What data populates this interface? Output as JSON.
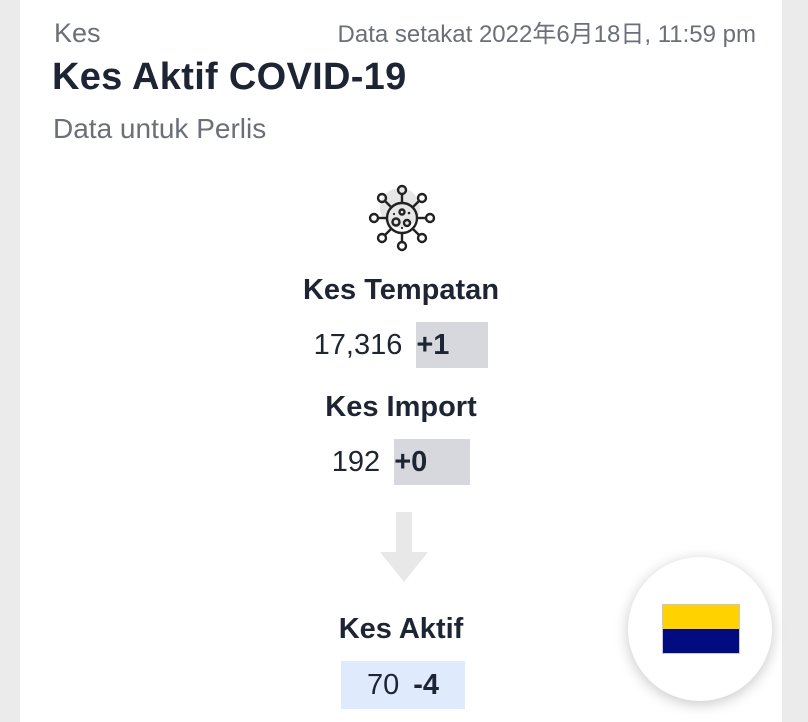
{
  "header": {
    "category": "Kes",
    "timestamp": "Data setakat 2022年6月18日, 11:59 pm",
    "title": "Kes Aktif COVID-19",
    "subtitle": "Data untuk Perlis"
  },
  "stats": {
    "local": {
      "label": "Kes Tempatan",
      "value": "17,316",
      "delta": "+1"
    },
    "import": {
      "label": "Kes Import",
      "value": "192",
      "delta": "+0"
    },
    "active": {
      "label": "Kes Aktif",
      "value": "70",
      "delta": "-4"
    }
  },
  "icons": {
    "virus": "virus-icon",
    "arrow": "arrow-down-icon"
  },
  "flag": {
    "top_color": "#ffd200",
    "bottom_color": "#000c80"
  },
  "colors": {
    "delta_bg": "#d6d8dd",
    "active_bg": "#dfeafc"
  }
}
